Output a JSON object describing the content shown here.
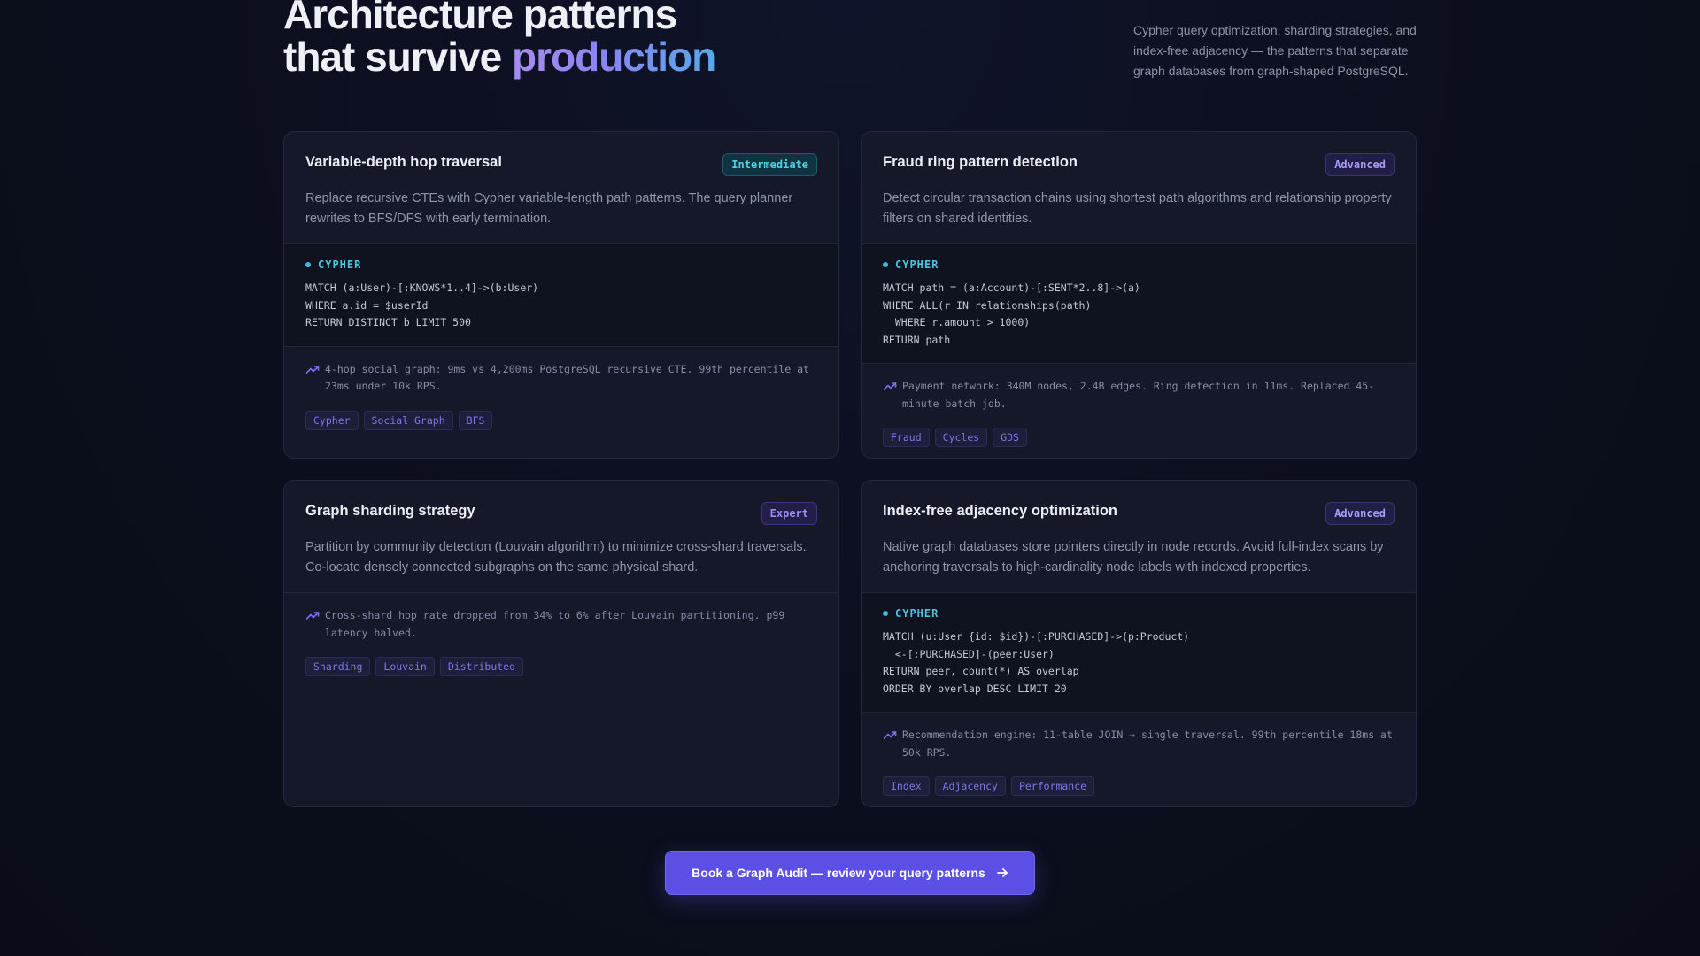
{
  "hero": {
    "title_line1": "Architecture patterns",
    "title_line2_plain": "that survive ",
    "title_line2_accent": "production",
    "description": "Cypher query optimization, sharding strategies, and index-free adjacency — the patterns that separate graph databases from graph-shaped PostgreSQL."
  },
  "cards": [
    {
      "title": "Variable-depth hop traversal",
      "badge": "Intermediate",
      "description": "Replace recursive CTEs with Cypher variable-length path patterns. The query planner rewrites to BFS/DFS with early termination.",
      "code_lang": "CYPHER",
      "code": "MATCH (a:User)-[:KNOWS*1..4]->(b:User)\nWHERE a.id = $userId\nRETURN DISTINCT b LIMIT 500",
      "metric": "4-hop social graph: 9ms vs 4,200ms PostgreSQL recursive CTE. 99th percentile at 23ms under 10k RPS.",
      "tags": [
        "Cypher",
        "Social Graph",
        "BFS"
      ]
    },
    {
      "title": "Fraud ring pattern detection",
      "badge": "Advanced",
      "description": "Detect circular transaction chains using shortest path algorithms and relationship property filters on shared identities.",
      "code_lang": "CYPHER",
      "code": "MATCH path = (a:Account)-[:SENT*2..8]->(a)\nWHERE ALL(r IN relationships(path)\n  WHERE r.amount > 1000)\nRETURN path",
      "metric": "Payment network: 340M nodes, 2.4B edges. Ring detection in 11ms. Replaced 45-minute batch job.",
      "tags": [
        "Fraud",
        "Cycles",
        "GDS"
      ]
    },
    {
      "title": "Graph sharding strategy",
      "badge": "Expert",
      "description": "Partition by community detection (Louvain algorithm) to minimize cross-shard traversals. Co-locate densely connected subgraphs on the same physical shard.",
      "metric": "Cross-shard hop rate dropped from 34% to 6% after Louvain partitioning. p99 latency halved.",
      "tags": [
        "Sharding",
        "Louvain",
        "Distributed"
      ]
    },
    {
      "title": "Index-free adjacency optimization",
      "badge": "Advanced",
      "description": "Native graph databases store pointers directly in node records. Avoid full-index scans by anchoring traversals to high-cardinality node labels with indexed properties.",
      "code_lang": "CYPHER",
      "code": "MATCH (u:User {id: $id})-[:PURCHASED]->(p:Product)\n  <-[:PURCHASED]-(peer:User)\nRETURN peer, count(*) AS overlap\nORDER BY overlap DESC LIMIT 20",
      "metric": "Recommendation engine: 11-table JOIN → single traversal. 99th percentile 18ms at 50k RPS.",
      "tags": [
        "Index",
        "Adjacency",
        "Performance"
      ]
    }
  ],
  "cta": {
    "label": "Book a Graph Audit — review your query patterns"
  },
  "icons": {
    "metric": "trending-up-icon",
    "cta": "arrow-right-icon"
  },
  "colors": {
    "accent": "#5b4fe6",
    "cyan": "#4fd1e0",
    "background": "#0b0e1c"
  }
}
